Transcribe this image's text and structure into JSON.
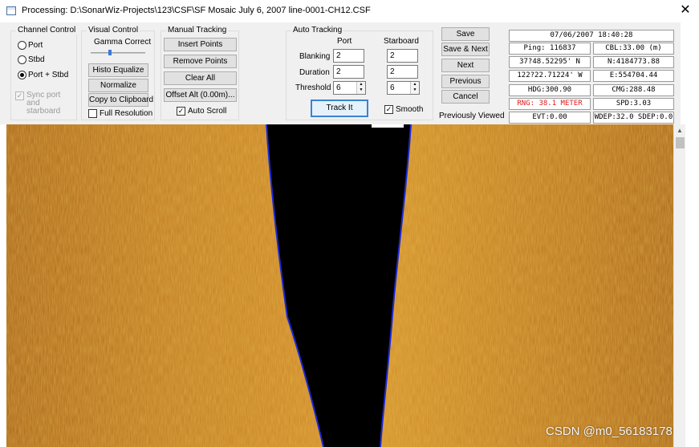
{
  "window": {
    "title": "Processing: D:\\SonarWiz-Projects\\123\\CSF\\SF Mosaic July 6, 2007 line-0001-CH12.CSF",
    "close_glyph": "✕"
  },
  "channel_control": {
    "label": "Channel Control",
    "options": [
      "Port",
      "Stbd",
      "Port + Stbd"
    ],
    "selected": "Port + Stbd",
    "sync_label": "Sync port and starboard",
    "sync_checked": true
  },
  "visual_control": {
    "label": "Visual Control",
    "gamma_label": "Gamma Correct",
    "gamma_level": 0.5,
    "histo_label": "Histo Equalize",
    "normalize_label": "Normalize",
    "copy_label": "Copy to Clipboard",
    "full_res_label": "Full Resolution",
    "full_res_checked": false
  },
  "manual_tracking": {
    "label": "Manual Tracking",
    "insert_label": "Insert Points",
    "remove_label": "Remove Points",
    "clear_label": "Clear All",
    "offset_label": "Offset Alt (0.00m)...",
    "auto_scroll_label": "Auto Scroll",
    "auto_scroll_checked": true
  },
  "auto_tracking": {
    "label": "Auto Tracking",
    "port_header": "Port",
    "stbd_header": "Starboard",
    "rows": [
      {
        "label": "Blanking",
        "port": "2",
        "stbd": "2"
      },
      {
        "label": "Duration",
        "port": "2",
        "stbd": "2"
      },
      {
        "label": "Threshold",
        "port": "6",
        "stbd": "6"
      }
    ],
    "spin_up": "▲",
    "spin_down": "▼",
    "track_label": "Track It",
    "smooth_label": "Smooth",
    "smooth_checked": true
  },
  "nav_buttons": {
    "save": "Save",
    "save_next": "Save & Next",
    "next": "Next",
    "previous": "Previous",
    "cancel": "Cancel",
    "previously_viewed": "Previously Viewed"
  },
  "info": {
    "datetime": "07/06/2007 18:40:28",
    "ping": "Ping: 116837",
    "cbl": "CBL:33.00 (m)",
    "lat": "37?48.52295' N",
    "northing": "N:4184773.88",
    "lon": "122?22.71224' W",
    "easting": "E:554704.44",
    "hdg": "HDG:300.90",
    "cmg": "CMG:288.48",
    "rng": "RNG: 38.1 METER",
    "spd": "SPD:3.03",
    "evt": "EVT:0.00",
    "depth": "WDEP:32.0 SDEP:0.0"
  },
  "colors": {
    "sonar_base": "#b8741c",
    "water_column": "#000000",
    "bottom_track": "#1e2bd6",
    "accent": "#3b83d0",
    "rng_text": "#e01818"
  },
  "scroll_up_glyph": "▲",
  "watermark": "CSDN @m0_56183178"
}
